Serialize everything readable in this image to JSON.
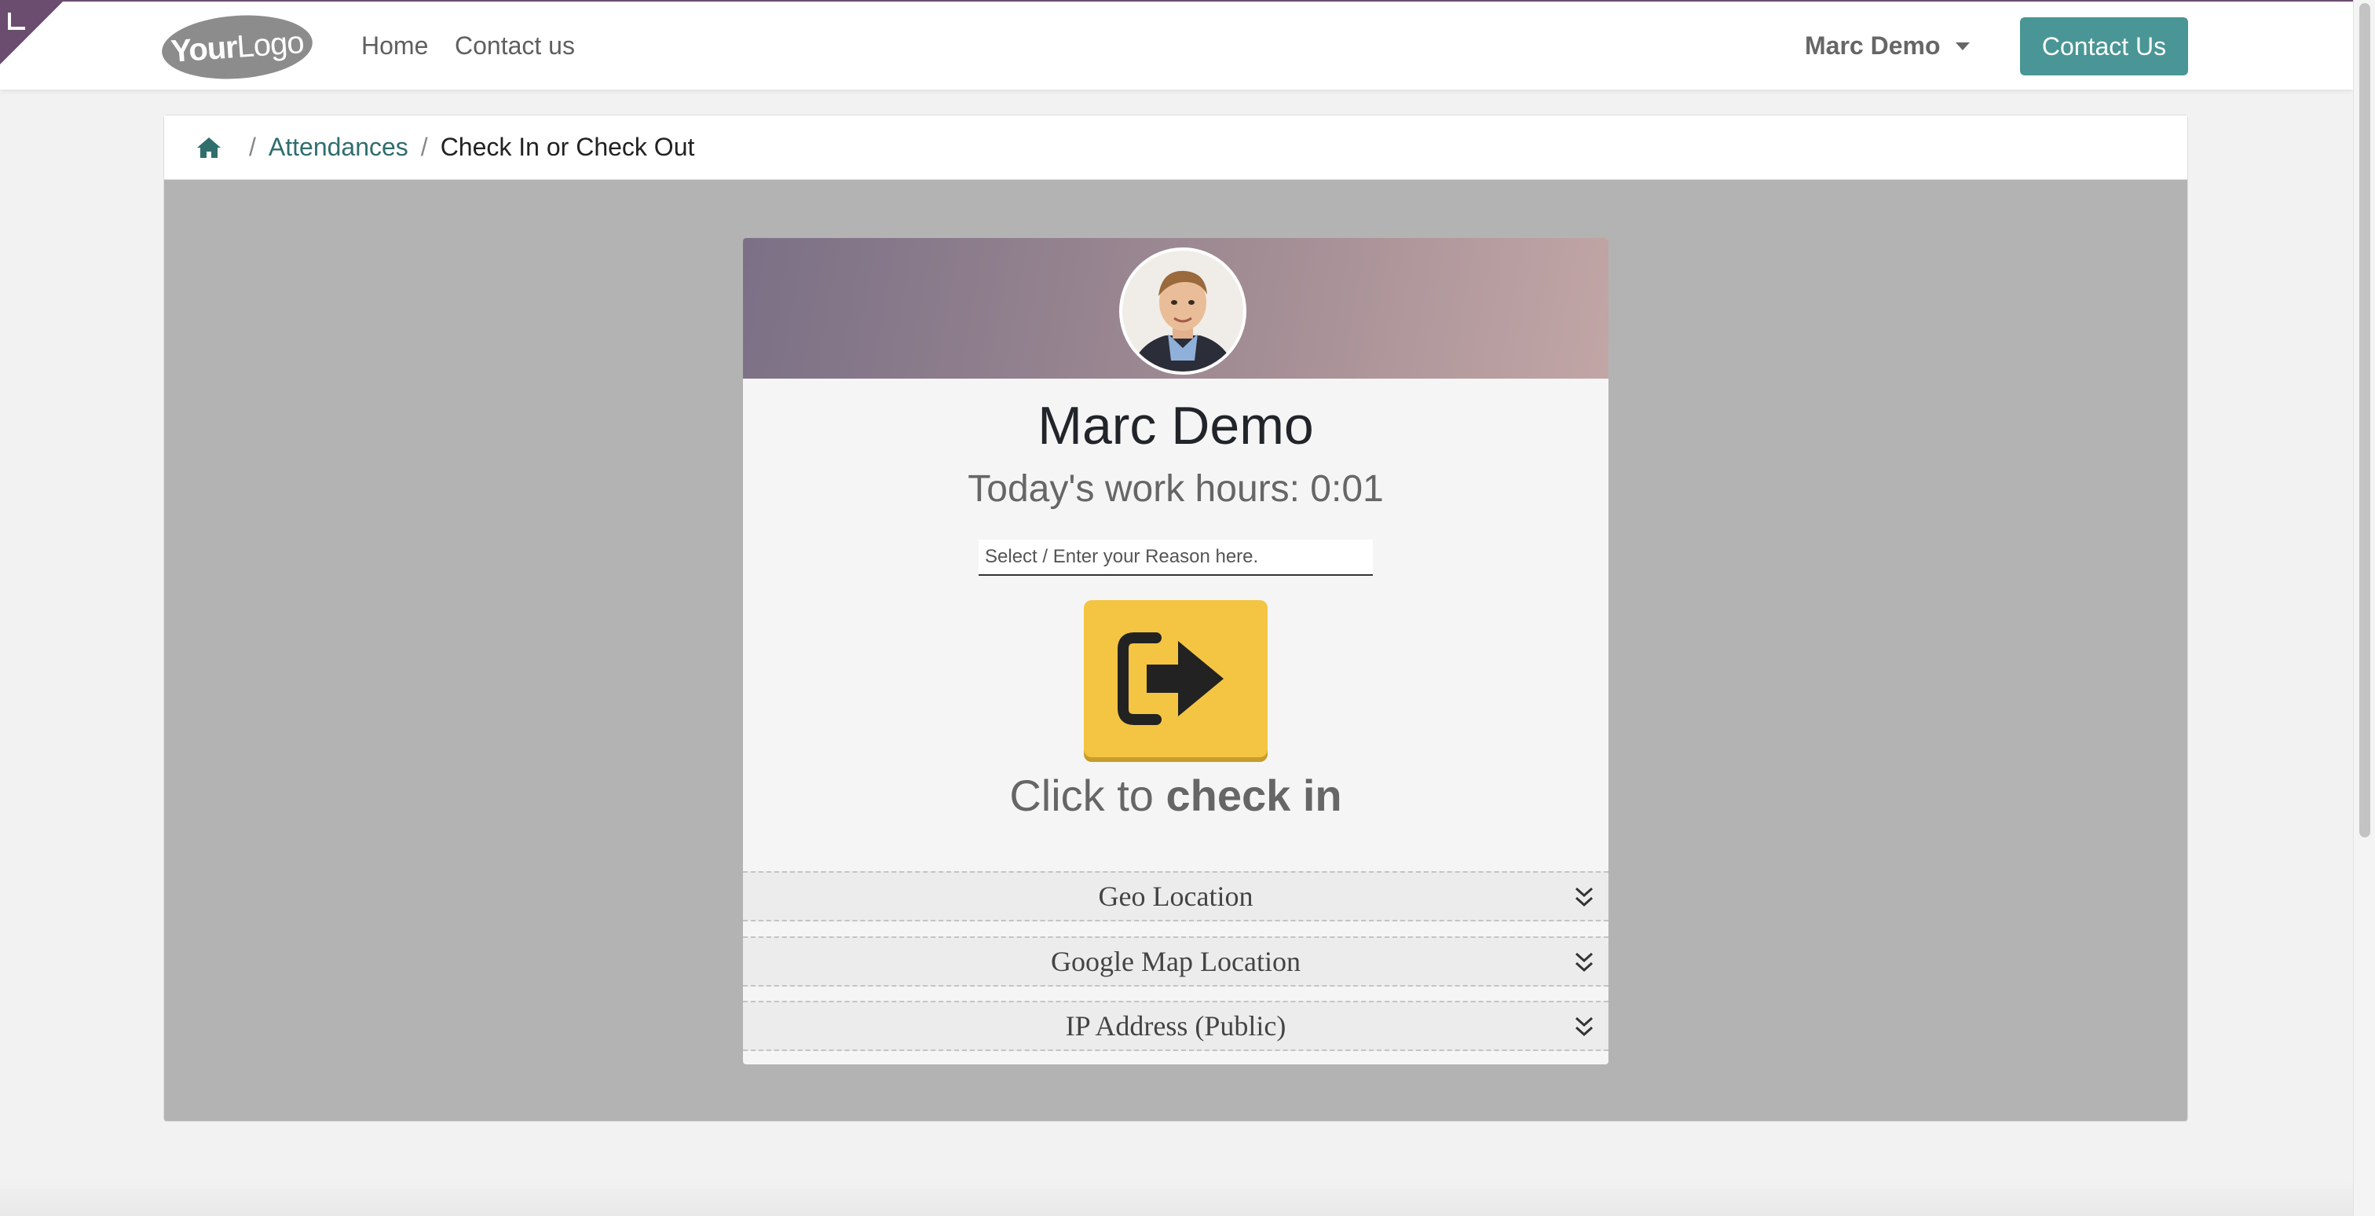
{
  "navbar": {
    "logo_text_bold": "Your",
    "logo_text_light": "Logo",
    "links": [
      "Home",
      "Contact us"
    ],
    "user_name": "Marc Demo",
    "cta_label": "Contact Us",
    "accent_color": "#4a9596"
  },
  "breadcrumb": {
    "home_icon": "home-icon",
    "items": [
      "Attendances",
      "Check In or Check Out"
    ],
    "separator": "/"
  },
  "attendance": {
    "employee_name": "Marc Demo",
    "work_hours": "Today's work hours: 0:01",
    "reason_placeholder": "Select / Enter your Reason here.",
    "button_icon": "sign-in-icon",
    "button_color": "#f4c542",
    "action_prefix": "Click to ",
    "action_strong": "check in",
    "sections": [
      "Geo Location",
      "Google Map Location",
      "IP Address (Public)"
    ]
  }
}
